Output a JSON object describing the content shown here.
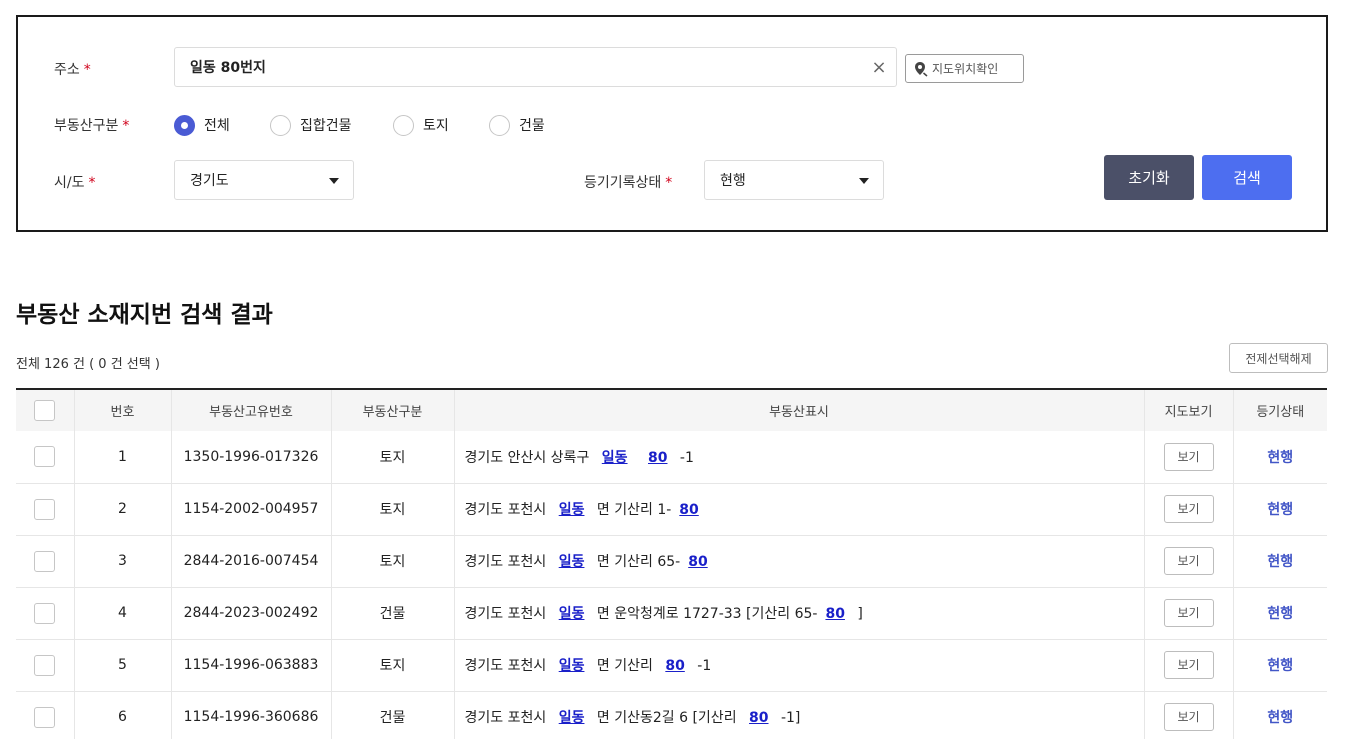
{
  "search": {
    "address": {
      "label": "주소",
      "required_mark": "*",
      "value": "일동 80번지",
      "clear_glyph": "×"
    },
    "map_location_button": "지도위치확인",
    "property_type": {
      "label": "부동산구분",
      "required_mark": "*",
      "options": [
        "전체",
        "집합건물",
        "토지",
        "건물"
      ],
      "selected": "전체"
    },
    "province": {
      "label": "시/도",
      "required_mark": "*",
      "value": "경기도"
    },
    "registry_status": {
      "label": "등기기록상태",
      "required_mark": "*",
      "value": "현행"
    },
    "reset_button": "초기화",
    "search_button": "검색"
  },
  "results": {
    "title": "부동산 소재지번 검색 결과",
    "count_text": "전체 126 건 ( 0 건 선택 )",
    "deselect_all_button": "전제선택해제",
    "columns": [
      "번호",
      "부동산고유번호",
      "부동산구분",
      "부동산표시",
      "지도보기",
      "등기상태"
    ],
    "view_label": "보기",
    "rows": [
      {
        "no": "1",
        "id": "1350-1996-017326",
        "type": "토지",
        "desc": [
          [
            "t",
            "경기도 안산시 상록구 "
          ],
          [
            "l",
            "일동"
          ],
          [
            "t",
            " "
          ],
          [
            "l",
            "80"
          ],
          [
            "t",
            " -1"
          ]
        ],
        "status": "현행"
      },
      {
        "no": "2",
        "id": "1154-2002-004957",
        "type": "토지",
        "desc": [
          [
            "t",
            "경기도 포천시 "
          ],
          [
            "l",
            "일동"
          ],
          [
            "t",
            " 면 기산리 1-"
          ],
          [
            "l",
            "80"
          ]
        ],
        "status": "현행"
      },
      {
        "no": "3",
        "id": "2844-2016-007454",
        "type": "토지",
        "desc": [
          [
            "t",
            "경기도 포천시 "
          ],
          [
            "l",
            "일동"
          ],
          [
            "t",
            " 면 기산리 65-"
          ],
          [
            "l",
            "80"
          ]
        ],
        "status": "현행"
      },
      {
        "no": "4",
        "id": "2844-2023-002492",
        "type": "건물",
        "desc": [
          [
            "t",
            "경기도 포천시 "
          ],
          [
            "l",
            "일동"
          ],
          [
            "t",
            " 면 운악청계로 1727-33 [기산리 65-"
          ],
          [
            "l",
            "80"
          ],
          [
            "t",
            " ]"
          ]
        ],
        "status": "현행"
      },
      {
        "no": "5",
        "id": "1154-1996-063883",
        "type": "토지",
        "desc": [
          [
            "t",
            "경기도 포천시 "
          ],
          [
            "l",
            "일동"
          ],
          [
            "t",
            " 면 기산리 "
          ],
          [
            "l",
            "80"
          ],
          [
            "t",
            " -1"
          ]
        ],
        "status": "현행"
      },
      {
        "no": "6",
        "id": "1154-1996-360686",
        "type": "건물",
        "desc": [
          [
            "t",
            "경기도 포천시 "
          ],
          [
            "l",
            "일동"
          ],
          [
            "t",
            " 면 기산동2길 6 [기산리 "
          ],
          [
            "l",
            "80"
          ],
          [
            "t",
            " -1]"
          ]
        ],
        "status": "현행"
      }
    ]
  },
  "colors": {
    "primary": "#4d6ef0",
    "reset": "#4b5068",
    "link": "#1a20c9",
    "status": "#4256c7",
    "required": "#d0021b"
  },
  "icons": {
    "map_location": "map-pin-search-icon",
    "select_caret": "caret-down-icon",
    "clear": "close-icon"
  }
}
